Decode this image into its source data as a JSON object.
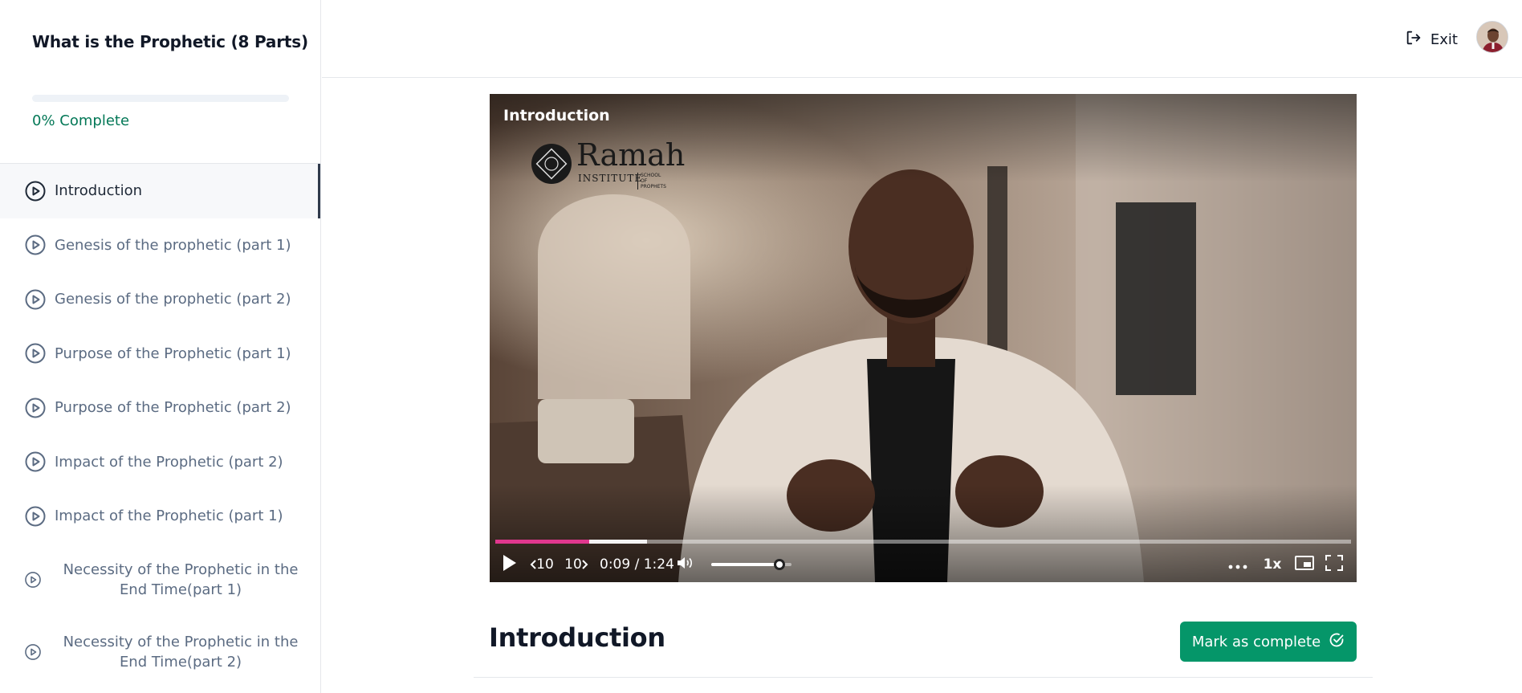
{
  "sidebar": {
    "course_title": "What is the Prophetic (8 Parts)",
    "progress_percent": 0,
    "progress_label": "0% Complete",
    "lessons": [
      {
        "label": "Introduction",
        "active": true
      },
      {
        "label": "Genesis of the prophetic (part 1)",
        "active": false
      },
      {
        "label": "Genesis of the prophetic (part 2)",
        "active": false
      },
      {
        "label": "Purpose of the Prophetic (part 1)",
        "active": false
      },
      {
        "label": "Purpose of the Prophetic (part 2)",
        "active": false
      },
      {
        "label": "Impact of the Prophetic (part 2)",
        "active": false
      },
      {
        "label": "Impact of the Prophetic (part 1)",
        "active": false
      },
      {
        "label": "Necessity of the Prophetic in the End Time(part 1)",
        "active": false
      },
      {
        "label": "Necessity of the Prophetic in the End Time(part 2)",
        "active": false
      }
    ],
    "lesson_icon": "play-circle-icon"
  },
  "header": {
    "exit_label": "Exit",
    "exit_icon": "sign-out-icon",
    "avatar_icon": "user-avatar"
  },
  "video": {
    "title": "Introduction",
    "logo": {
      "name": "Ramah",
      "sub": "INSTITUTE",
      "sub2": "SCHOOL OF PROPHETS"
    },
    "time_display": "0:09 / 1:24",
    "played_fraction": 0.11,
    "buffered_fraction": 0.177,
    "volume_fraction": 0.85,
    "rewind_label": "10",
    "forward_label": "10",
    "speed_label": "1x",
    "icons": [
      "play-icon",
      "rewind-10-icon",
      "forward-10-icon",
      "volume-icon",
      "more-icon",
      "pip-icon",
      "fullscreen-icon"
    ]
  },
  "main": {
    "lesson_heading": "Introduction",
    "complete_button_label": "Mark as complete",
    "complete_icon": "check-circle-icon"
  },
  "colors": {
    "accent_green": "#059669",
    "progress_text": "#047857",
    "seek_played": "#e0378e"
  }
}
